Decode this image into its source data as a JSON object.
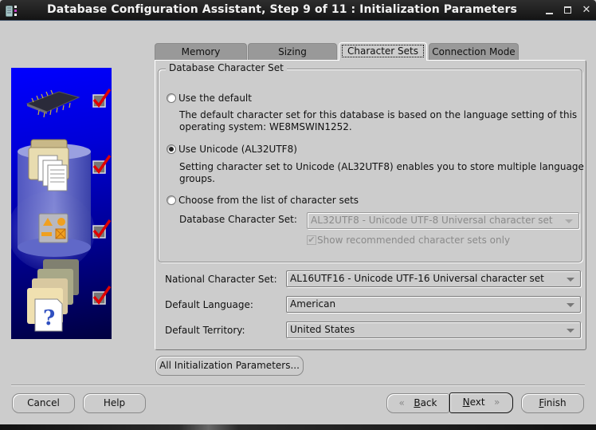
{
  "window": {
    "title": "Database Configuration Assistant, Step 9 of 11 : Initialization Parameters",
    "controls": {
      "minimize": "minimize",
      "maximize": "maximize",
      "close": "close"
    }
  },
  "side_panel": {
    "steps": [
      {
        "icon": "memory-chip-icon",
        "checked": true
      },
      {
        "icon": "database-files-icon",
        "checked": true
      },
      {
        "icon": "shapes-options-icon",
        "checked": true
      },
      {
        "icon": "help-documents-icon",
        "checked": true
      }
    ],
    "check_color": "#e00000"
  },
  "tabs": [
    {
      "label": "Memory",
      "active": false
    },
    {
      "label": "Sizing",
      "active": false
    },
    {
      "label": "Character Sets",
      "active": true
    },
    {
      "label": "Connection Mode",
      "active": false
    }
  ],
  "db_charset_group": {
    "legend": "Database Character Set",
    "options": [
      {
        "label": "Use the default",
        "selected": false,
        "description_line1": "The default character set for this database is based on the language setting of this",
        "description_line2": "operating system: WE8MSWIN1252."
      },
      {
        "label": "Use Unicode (AL32UTF8)",
        "selected": true,
        "description_line1": "Setting character set to Unicode (AL32UTF8) enables you to store multiple language",
        "description_line2": "groups."
      },
      {
        "label": "Choose from the list of character sets",
        "selected": false
      }
    ],
    "charset_field_label": "Database Character Set:",
    "charset_field_value": "AL32UTF8 - Unicode UTF-8 Universal character set",
    "charset_field_enabled": false,
    "recommended_only_label": "Show recommended character sets only",
    "recommended_only_checked": true,
    "recommended_only_enabled": false
  },
  "fields": {
    "national_charset": {
      "label": "National Character Set:",
      "value": "AL16UTF16 - Unicode UTF-16 Universal character set"
    },
    "default_language": {
      "label": "Default Language:",
      "value": "American"
    },
    "default_territory": {
      "label": "Default Territory:",
      "value": "United States"
    }
  },
  "buttons": {
    "all_init_params": "All Initialization Parameters...",
    "cancel": "Cancel",
    "help": "Help",
    "back_mnemonic": "B",
    "back_rest": "ack",
    "next_mnemonic": "N",
    "next_rest": "ext",
    "finish_mnemonic": "F",
    "finish_rest": "inish",
    "back_chevron": "«",
    "next_chevron": "»"
  }
}
